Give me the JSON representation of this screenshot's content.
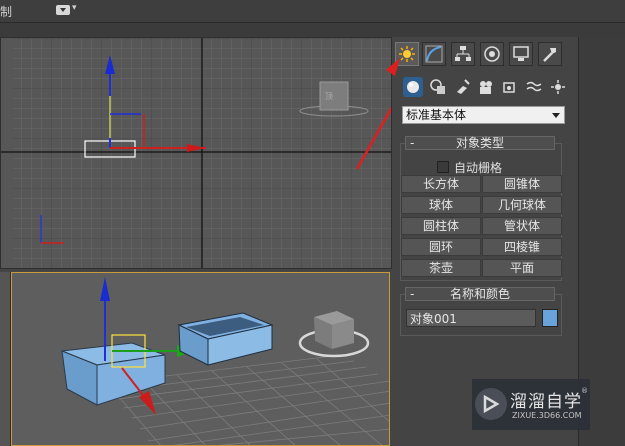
{
  "topbar": {
    "label_fragment": "制",
    "arrow": "▾"
  },
  "panel": {
    "tabs": [
      {
        "icon": "create-icon",
        "active": true
      },
      {
        "icon": "modify-icon",
        "active": false
      },
      {
        "icon": "hierarchy-icon",
        "active": false
      },
      {
        "icon": "motion-icon",
        "active": false
      },
      {
        "icon": "display-icon",
        "active": false
      },
      {
        "icon": "utilities-icon",
        "active": false
      }
    ],
    "subtabs": [
      {
        "icon": "geometry-icon",
        "active": true
      },
      {
        "icon": "shapes-icon"
      },
      {
        "icon": "lights-icon"
      },
      {
        "icon": "cameras-icon"
      },
      {
        "icon": "helpers-icon"
      },
      {
        "icon": "spacewarps-icon"
      },
      {
        "icon": "systems-icon"
      }
    ],
    "category_dropdown": "标准基本体",
    "object_type": {
      "title": "对象类型",
      "collapse": "-",
      "autogrid_label": "自动栅格",
      "buttons": [
        "长方体",
        "圆锥体",
        "球体",
        "几何球体",
        "圆柱体",
        "管状体",
        "圆环",
        "四棱锥",
        "茶壶",
        "平面"
      ]
    },
    "name_color": {
      "title": "名称和颜色",
      "collapse": "-",
      "name_value": "对象001",
      "swatch_color": "#6aa2dc"
    }
  },
  "watermark": {
    "title": "溜溜自学",
    "url": "ZIXUE.3D66.COM",
    "registered": "®"
  },
  "colors": {
    "annotation_red": "#dd1f1f",
    "object_blue": "#7eaedb",
    "viewport_border_active": "#c79a3a"
  }
}
